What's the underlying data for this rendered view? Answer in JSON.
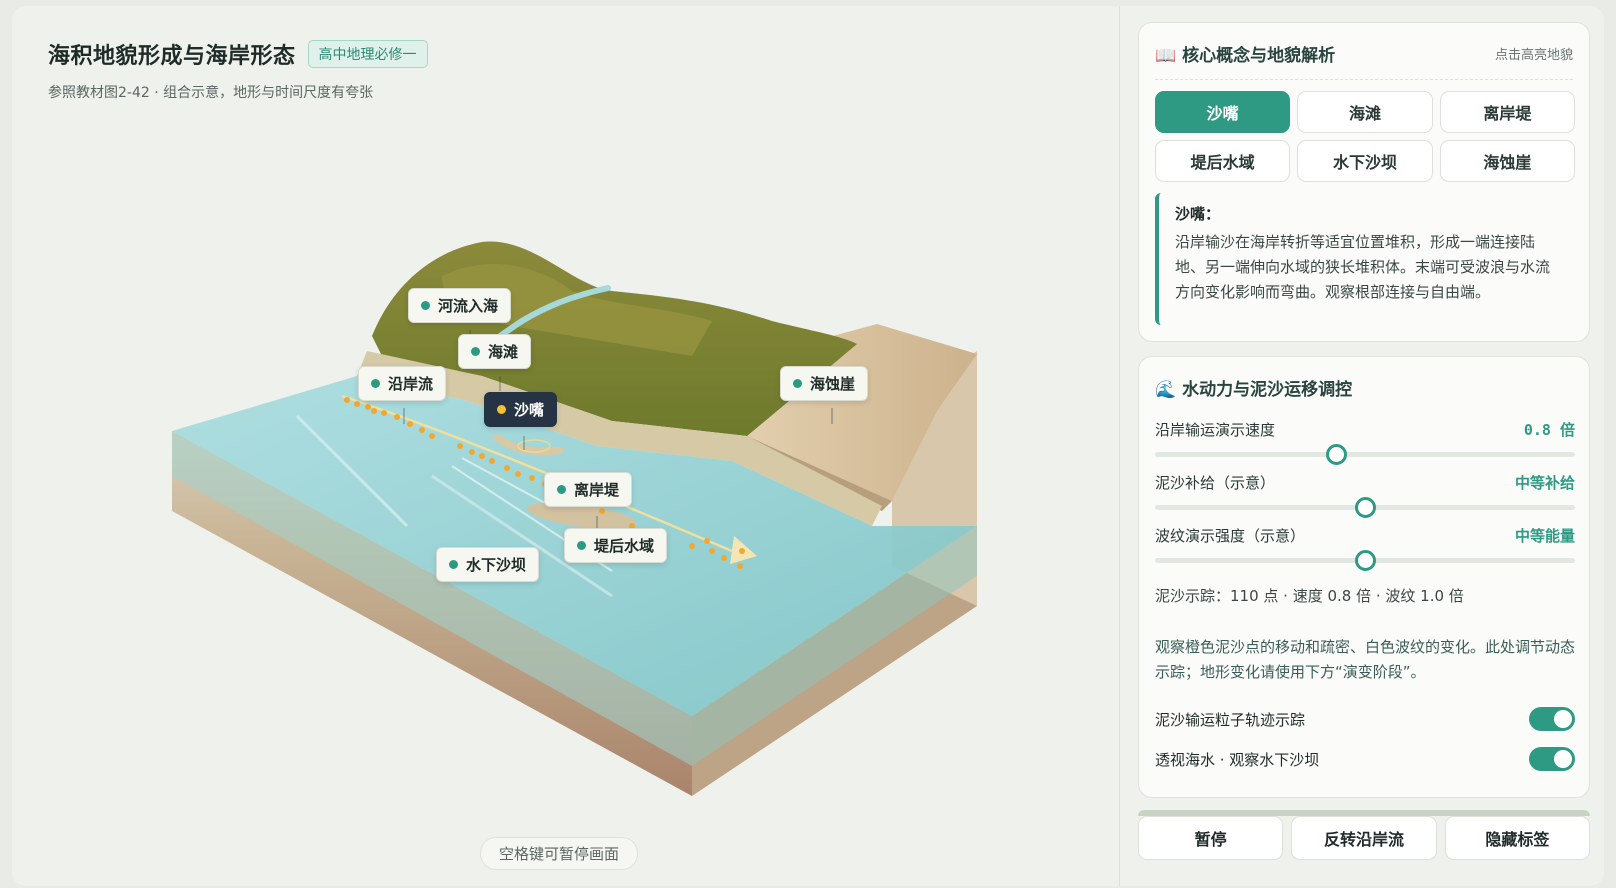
{
  "header": {
    "title": "海积地貌形成与海岸形态",
    "badge": "高中地理必修一",
    "subtitle": "参照教材图2-42 · 组合示意，地形与时间尺度有夸张"
  },
  "scene_labels": {
    "river_mouth": "河流入海",
    "beach": "海滩",
    "longshore_current": "沿岸流",
    "spit": "沙嘴",
    "sea_cliff": "海蚀崖",
    "offshore_bar": "离岸堤",
    "lagoon": "堤后水域",
    "submarine_bar": "水下沙坝"
  },
  "pause_hint": "空格键可暂停画面",
  "concept_card": {
    "icon": "📖",
    "title": "核心概念与地貌解析",
    "hint": "点击高亮地貌",
    "tabs": [
      "沙嘴",
      "海滩",
      "离岸堤",
      "堤后水域",
      "水下沙坝",
      "海蚀崖"
    ],
    "active_tab": "沙嘴",
    "detail_title": "沙嘴：",
    "detail_body": "沿岸输沙在海岸转折等适宜位置堆积，形成一端连接陆地、另一端伸向水域的狭长堆积体。末端可受波浪与水流方向变化影响而弯曲。观察根部连接与自由端。"
  },
  "control_card": {
    "icon": "🌊",
    "title": "水动力与泥沙运移调控",
    "sliders": [
      {
        "label": "沿岸输运演示速度",
        "value": "0.8 倍",
        "level": 0.43
      },
      {
        "label": "泥沙补给（示意）",
        "value": "中等补给",
        "level": 0.5
      },
      {
        "label": "波纹演示强度（示意）",
        "value": "中等能量",
        "level": 0.5
      }
    ],
    "trace": "泥沙示踪：110 点 · 速度 0.8 倍 · 波纹 1.0 倍",
    "note": "观察橙色泥沙点的移动和疏密、白色波纹的变化。此处调节动态示踪；地形变化请使用下方“演变阶段”。",
    "toggles": [
      {
        "label": "泥沙输运粒子轨迹示踪",
        "on": true
      },
      {
        "label": "透视海水 · 观察水下沙坝",
        "on": true
      }
    ]
  },
  "actions": {
    "pause": "暂停",
    "reverse": "反转沿岸流",
    "hide_labels": "隐藏标签"
  },
  "colors": {
    "accent": "#2f9a84",
    "active_label_bg": "#263344",
    "sediment": "#f0a830",
    "sea": "#8fd0d2"
  }
}
